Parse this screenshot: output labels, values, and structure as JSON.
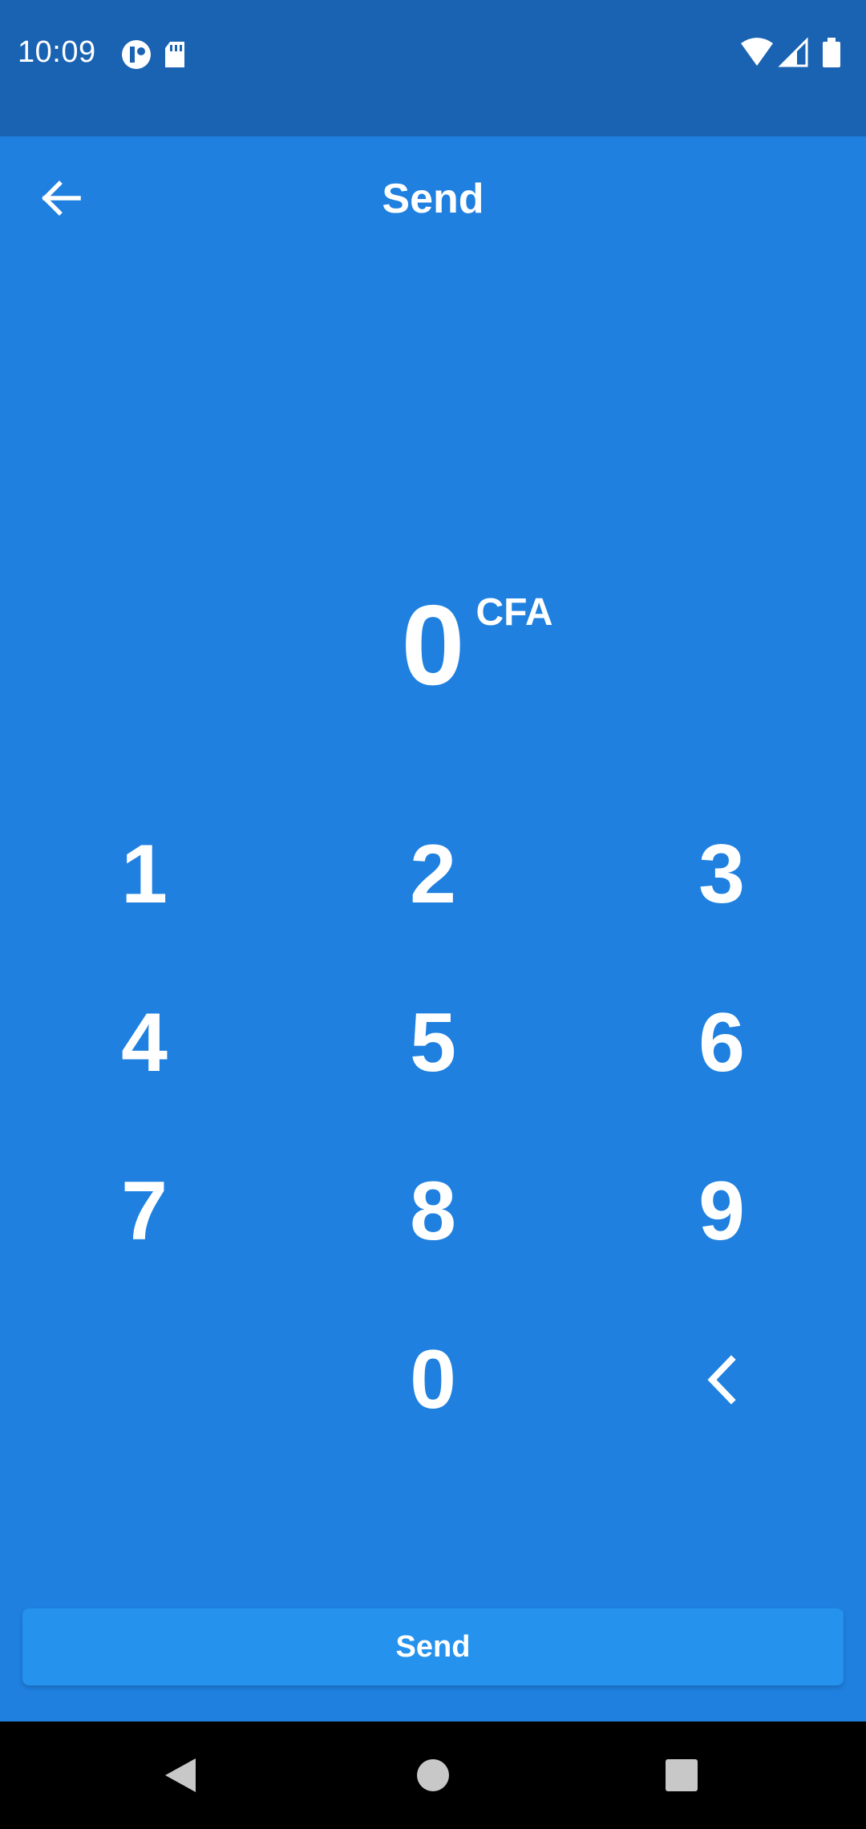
{
  "status_bar": {
    "time": "10:09",
    "left_icons": [
      "data-saver-icon",
      "sd-card-icon"
    ],
    "right_icons": [
      "wifi-icon",
      "cellular-signal-icon",
      "battery-icon"
    ]
  },
  "app_bar": {
    "title": "Send",
    "back_icon": "arrow-back-icon"
  },
  "amount": {
    "value": "0",
    "currency": "CFA"
  },
  "keypad": {
    "keys": [
      "1",
      "2",
      "3",
      "4",
      "5",
      "6",
      "7",
      "8",
      "9",
      "0"
    ],
    "backspace_icon": "chevron-left-icon"
  },
  "send_button": {
    "label": "Send"
  },
  "nav_bar": {
    "icons": [
      "back-triangle-icon",
      "home-circle-icon",
      "recents-square-icon"
    ]
  },
  "colors": {
    "status_bar": "#1a62b2",
    "background": "#1f80e0",
    "button": "#2592ee",
    "text": "#ffffff",
    "nav_bar": "#000000"
  }
}
